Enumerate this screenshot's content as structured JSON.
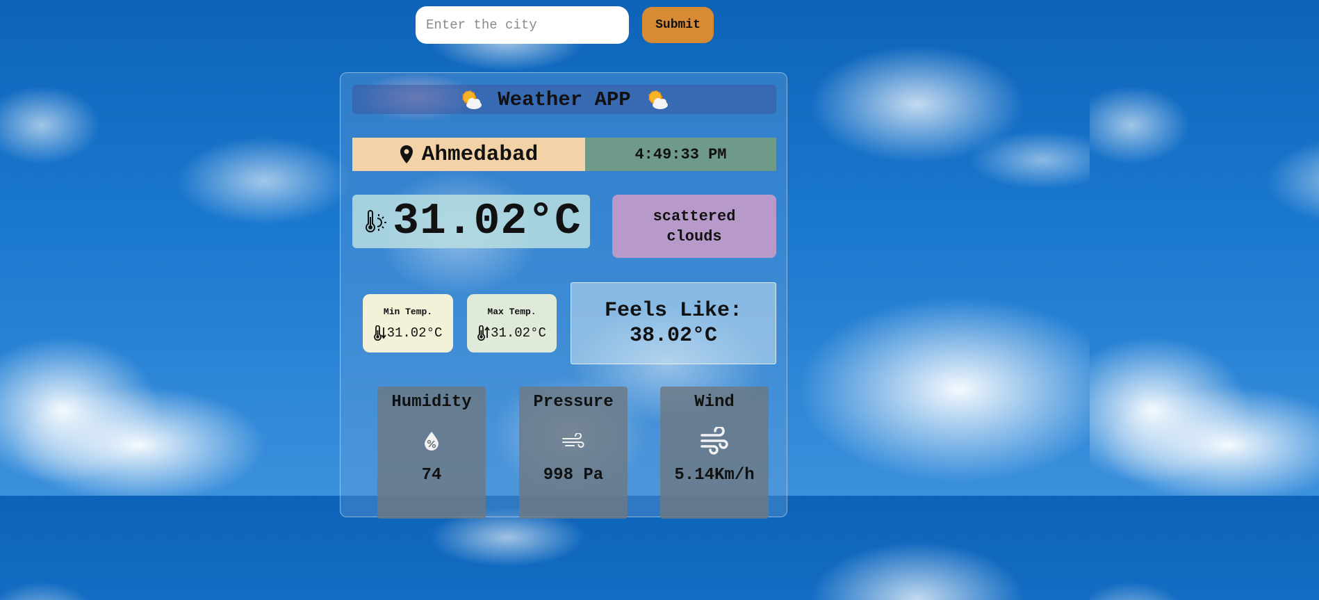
{
  "search": {
    "placeholder": "Enter the city",
    "value": "",
    "submit_label": "Submit"
  },
  "header": {
    "title": "Weather APP",
    "icon": "sun-behind-cloud-icon"
  },
  "location": {
    "city": "Ahmedabad",
    "icon": "map-pin-icon"
  },
  "time": "4:49:33 PM",
  "temperature": {
    "current": "31.02°C",
    "icon": "thermometer-sun-icon",
    "description": "scattered clouds"
  },
  "min_temp": {
    "label": "Min Temp.",
    "value": "31.02°C",
    "icon": "thermometer-down-icon"
  },
  "max_temp": {
    "label": "Max Temp.",
    "value": "31.02°C",
    "icon": "thermometer-up-icon"
  },
  "feels_like": {
    "label": "Feels Like:",
    "value": "38.02°C"
  },
  "stats": {
    "humidity": {
      "label": "Humidity",
      "value": "74",
      "icon": "humidity-drop-icon"
    },
    "pressure": {
      "label": "Pressure",
      "value": "998 Pa",
      "icon": "pressure-wind-icon"
    },
    "wind": {
      "label": "Wind",
      "value": "5.14Km/h",
      "icon": "wind-icon"
    }
  },
  "colors": {
    "submit_button": "#d98a34",
    "city_box": "#f2d2a6",
    "time_box": "#6f9a89",
    "description_box": "#b79ac9",
    "min_box": "#f3f1d8",
    "max_box": "#dfebd8"
  }
}
